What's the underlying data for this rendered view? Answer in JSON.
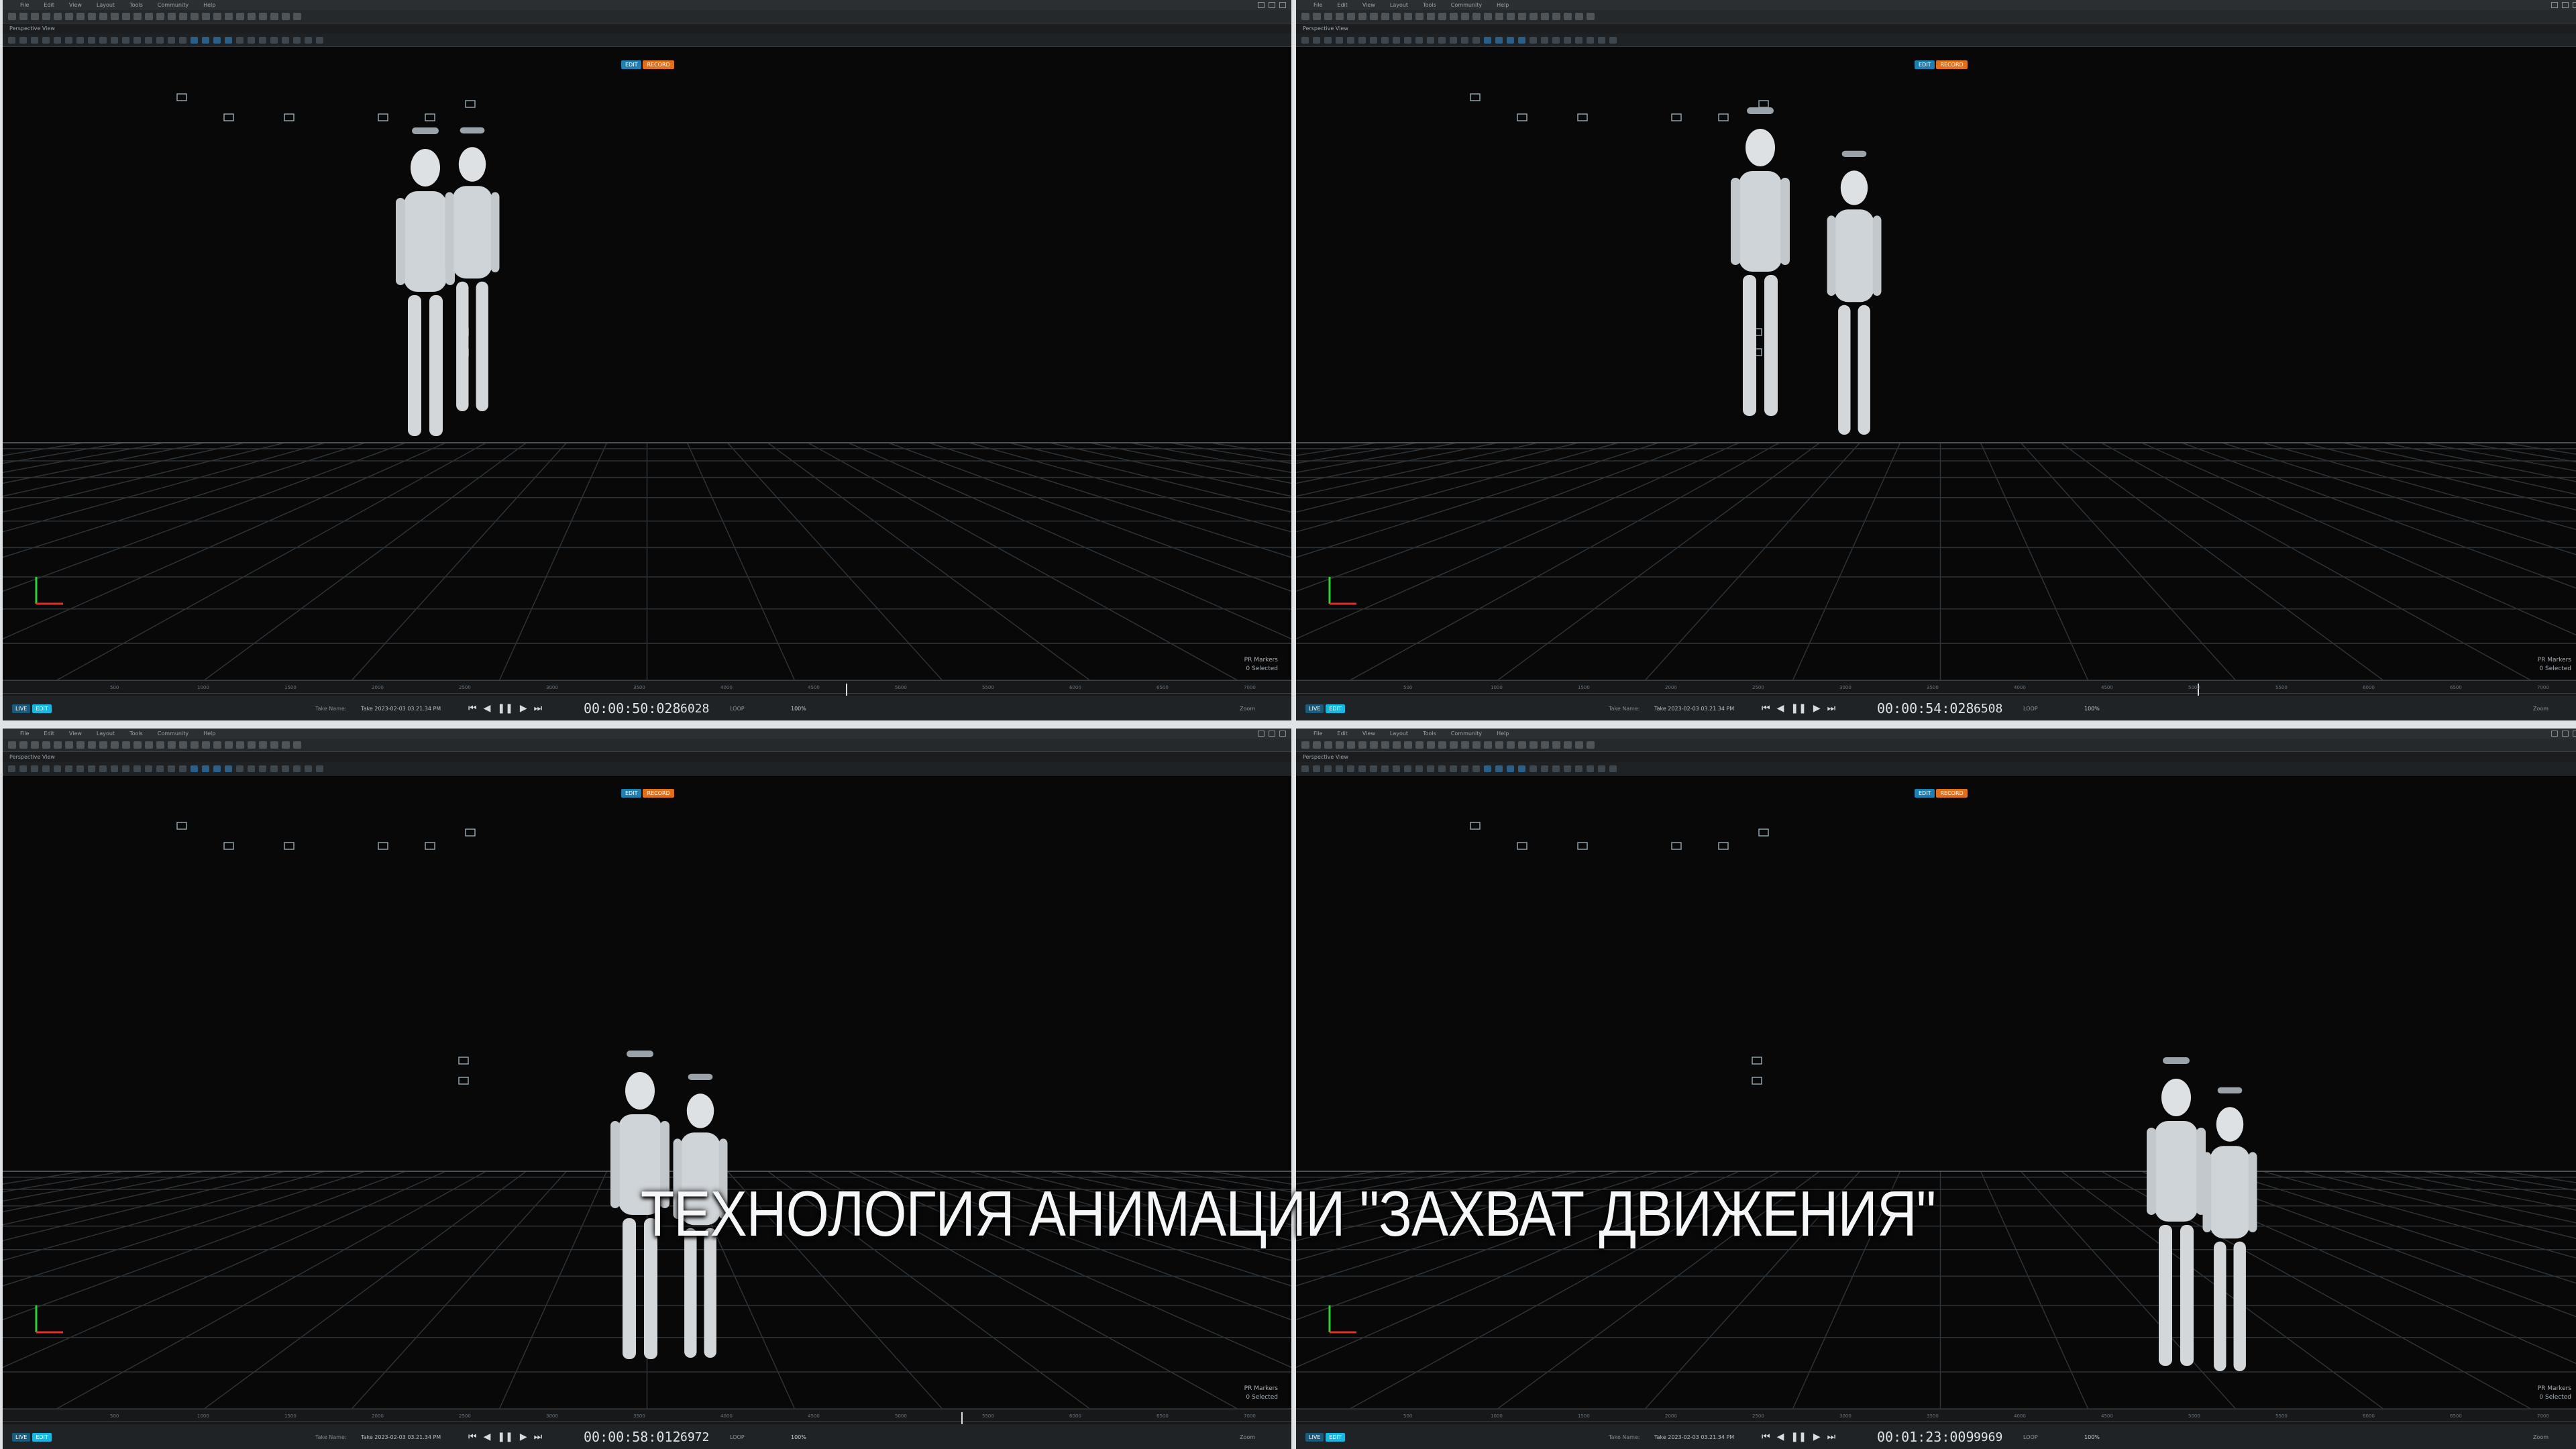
{
  "menu": [
    "File",
    "Edit",
    "View",
    "Layout",
    "Tools",
    "Community",
    "Help"
  ],
  "view_label": "Perspective View",
  "modes": [
    "EDIT",
    "RECORD"
  ],
  "record_labels": [
    "LIVE",
    "EDIT"
  ],
  "take_label": "Take Name:",
  "take_name": "Take 2023-02-03 03.21.34 PM",
  "loop_label": "LOOP",
  "speed_label": "100%",
  "zoom_label": "Zoom",
  "icons": {
    "skip_start": "skip-to-start-icon",
    "step_back": "step-back-icon",
    "pause": "pause-icon",
    "step_fwd": "step-forward-icon",
    "skip_end": "skip-to-end-icon"
  },
  "ruler_ticks": [
    "500",
    "1000",
    "1500",
    "2000",
    "2500",
    "3000",
    "3500",
    "4000",
    "4500",
    "5000",
    "5500",
    "6000",
    "6500",
    "7000"
  ],
  "panels": [
    {
      "timecode": "00:00:50:028",
      "frame": "6028",
      "info1": "PR Markers",
      "info2": "0 Selected"
    },
    {
      "timecode": "00:00:54:028",
      "frame": "6508",
      "info1": "PR Markers",
      "info2": "0 Selected"
    },
    {
      "timecode": "00:00:58:012",
      "frame": "6972",
      "info1": "PR Markers",
      "info2": "0 Selected"
    },
    {
      "timecode": "00:01:23:009",
      "frame": "9969",
      "info1": "PR Markers",
      "info2": "0 Selected"
    }
  ],
  "overlay_title": "ТЕХНОЛОГИЯ АНИМАЦИИ \"ЗАХВАТ ДВИЖЕНИЯ\"",
  "colors": {
    "accent_blue": "#18b6e0",
    "accent_orange": "#e0701c",
    "grid": "#3a3f44"
  }
}
